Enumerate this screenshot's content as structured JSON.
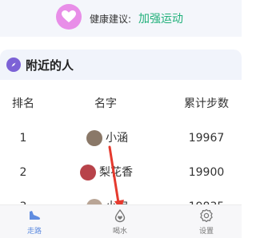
{
  "health": {
    "label": "健康建议:",
    "value": "加强运动",
    "colors": {
      "heart_bg": "#e88ee8",
      "value": "#20b07a"
    }
  },
  "nearby": {
    "title": "附近的人",
    "icon": "compass-icon"
  },
  "table": {
    "headers": {
      "rank": "排名",
      "name": "名字",
      "steps": "累计步数"
    },
    "rows": [
      {
        "rank": "1",
        "name": "小涵",
        "steps": "19967"
      },
      {
        "rank": "2",
        "name": "梨花香",
        "steps": "19900"
      },
      {
        "rank": "3",
        "name": "小宝",
        "steps": "19835"
      }
    ]
  },
  "tabs": [
    {
      "label": "走路",
      "icon": "shoe-icon",
      "active": true
    },
    {
      "label": "喝水",
      "icon": "water-drop-icon",
      "active": false
    },
    {
      "label": "设置",
      "icon": "gear-icon",
      "active": false
    }
  ],
  "accent": "#5f8ce0",
  "annotation_color": "#e53a2e"
}
